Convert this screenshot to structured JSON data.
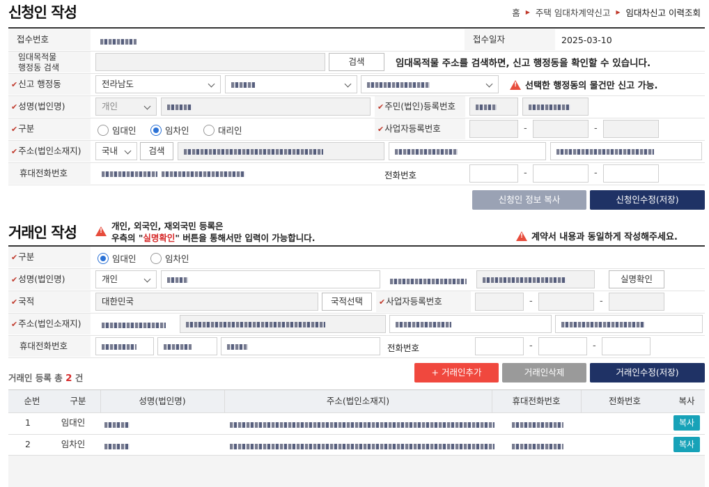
{
  "applicant": {
    "title": "신청인 작성",
    "breadcrumb": {
      "home": "홈",
      "section": "주택 임대차계약신고",
      "current": "임대차신고 이력조회"
    },
    "receipt_no_label": "접수번호",
    "receipt_date_label": "접수일자",
    "receipt_date": "2025-03-10",
    "addr_search_label": "임대목적물\n행정동 검색",
    "search_button": "검색",
    "addr_search_hint": "임대목적물 주소를 검색하면, 신고 행정동을 확인할 수 있습니다.",
    "dong_label": "신고 행정동",
    "province": "전라남도",
    "dong_warning": "선택한 행정동의 물건만 신고 가능.",
    "name_label": "성명(법인명)",
    "person_type": "개인",
    "rrn_label": "주민(법인)등록번호",
    "type_label": "구분",
    "radio_lessor": "임대인",
    "radio_lessee": "임차인",
    "radio_agent": "대리인",
    "biz_label": "사업자등록번호",
    "address_label": "주소(법인소재지)",
    "domestic": "국내",
    "mobile_label": "휴대전화번호",
    "phone_label": "전화번호",
    "copy_info_button": "신청인 정보 복사",
    "save_button": "신청인수정(저장)"
  },
  "counterparty": {
    "title": "거래인 작성",
    "notice_line1": "개인, 외국인, 재외국민 등록은",
    "notice_line2_pre": "우측의 \"",
    "notice_highlight": "실명확인",
    "notice_line2_post": "\" 버튼을 통해서만 입력이 가능합니다.",
    "contract_warning": "계약서 내용과 동일하게 작성해주세요.",
    "type_label": "구분",
    "radio_lessor": "임대인",
    "radio_lessee": "임차인",
    "name_label": "성명(법인명)",
    "person_type": "개인",
    "verify_button": "실명확인",
    "nationality_label": "국적",
    "nationality": "대한민국",
    "nationality_button": "국적선택",
    "biz_label": "사업자등록번호",
    "address_label": "주소(법인소재지)",
    "mobile_label": "휴대전화번호",
    "phone_label": "전화번호",
    "count_pre": "거래인 등록 총",
    "count": "2",
    "count_post": "건",
    "add_button": "+ 거래인추가",
    "delete_button": "거래인삭제",
    "save_button": "거래인수정(저장)"
  },
  "table": {
    "headers": [
      "순번",
      "구분",
      "성명(법인명)",
      "주소(법인소재지)",
      "휴대전화번호",
      "전화번호",
      "복사"
    ],
    "rows": [
      {
        "no": "1",
        "type": "임대인",
        "copy": "복사"
      },
      {
        "no": "2",
        "type": "임차인",
        "copy": "복사"
      }
    ]
  },
  "colors": {
    "required": "#c0392b",
    "primary": "#1f3265",
    "warning": "#e74c3c",
    "accent": "#17a2b8",
    "add": "#f0483e"
  }
}
